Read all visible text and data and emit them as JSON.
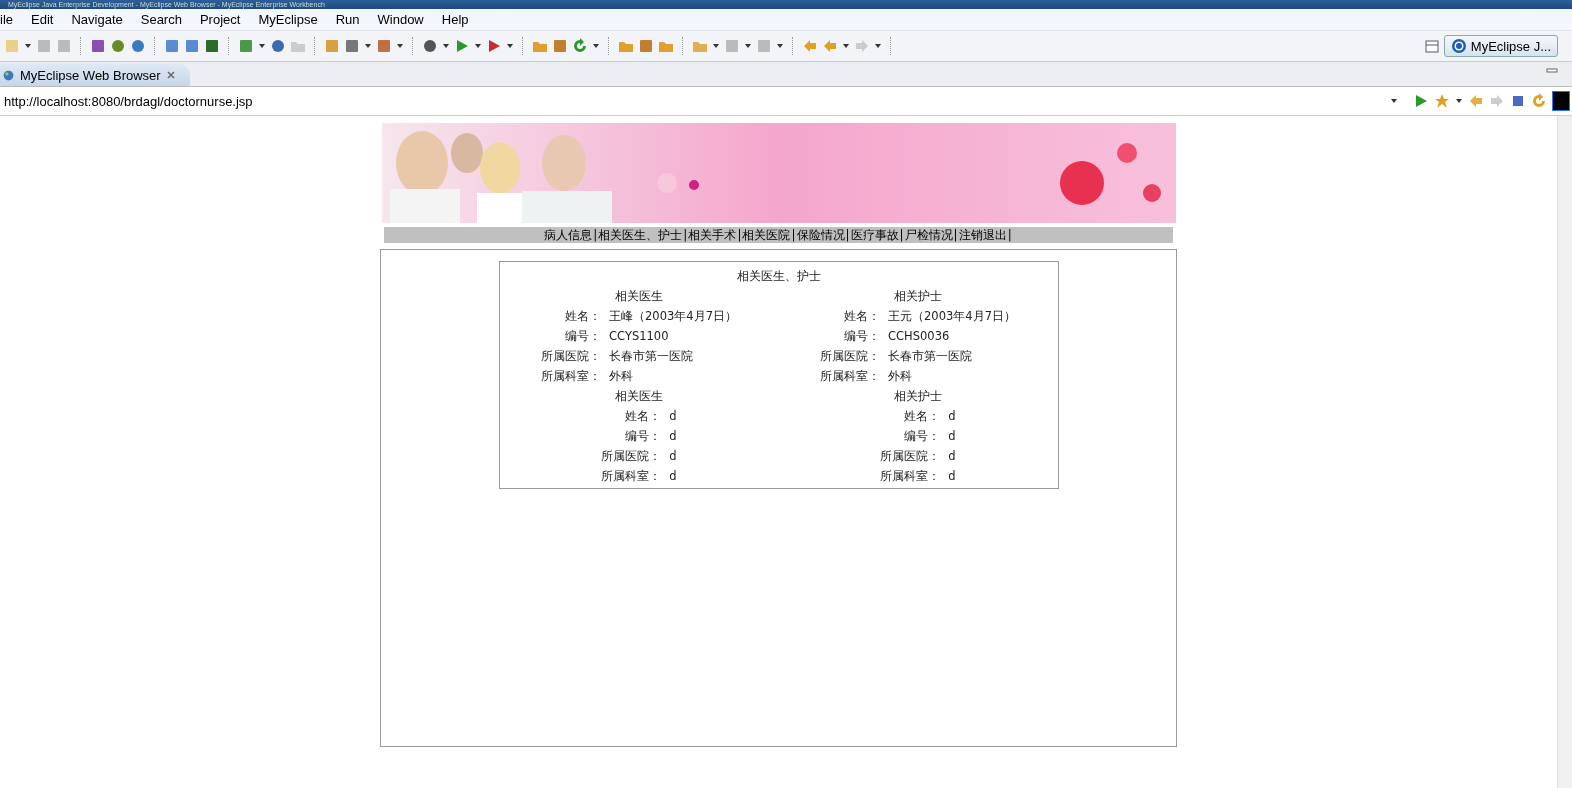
{
  "window": {
    "title": "MyEclipse Java Enterprise Development - MyEclipse Web Browser - MyEclipse Enterprise Workbench"
  },
  "menu": [
    "ile",
    "Edit",
    "Navigate",
    "Search",
    "Project",
    "MyEclipse",
    "Run",
    "Window",
    "Help"
  ],
  "perspective": {
    "label": "MyEclipse J..."
  },
  "editor_tab": {
    "label": "MyEclipse Web Browser",
    "selected": true
  },
  "browser": {
    "url": "http://localhost:8080/brdagl/doctornurse.jsp"
  },
  "page": {
    "nav": [
      {
        "label": "病人信息",
        "separator": "|"
      },
      {
        "label": "相关医生、护士",
        "separator": "|"
      },
      {
        "label": "相关手术",
        "separator": "|"
      },
      {
        "label": "相关医院",
        "separator": "|"
      },
      {
        "label": "保险情况",
        "separator": "|"
      },
      {
        "label": "医疗事故",
        "separator": "|"
      },
      {
        "label": "尸检情况",
        "separator": "|"
      },
      {
        "label": "注销退出",
        "separator": "|"
      }
    ],
    "title": "相关医生、护士",
    "rows": [
      [
        {
          "heading": "相关医生",
          "fields": [
            {
              "label": "姓名：",
              "value": "王峰（2003年4月7日）"
            },
            {
              "label": "编号：",
              "value": "CCYS1100"
            },
            {
              "label": "所属医院：",
              "value": "长春市第一医院"
            },
            {
              "label": "所属科室：",
              "value": "外科"
            }
          ]
        },
        {
          "heading": "相关护士",
          "fields": [
            {
              "label": "姓名：",
              "value": "王元（2003年4月7日）"
            },
            {
              "label": "编号：",
              "value": "CCHS0036"
            },
            {
              "label": "所属医院：",
              "value": "长春市第一医院"
            },
            {
              "label": "所属科室：",
              "value": "外科"
            }
          ]
        }
      ],
      [
        {
          "heading": "相关医生",
          "fields": [
            {
              "label": "姓名：",
              "value": "d"
            },
            {
              "label": "编号：",
              "value": "d"
            },
            {
              "label": "所属医院：",
              "value": "d"
            },
            {
              "label": "所属科室：",
              "value": "d"
            }
          ]
        },
        {
          "heading": "相关护士",
          "fields": [
            {
              "label": "姓名：",
              "value": "d"
            },
            {
              "label": "编号：",
              "value": "d"
            },
            {
              "label": "所属医院：",
              "value": "d"
            },
            {
              "label": "所属科室：",
              "value": "d"
            }
          ]
        }
      ]
    ]
  }
}
